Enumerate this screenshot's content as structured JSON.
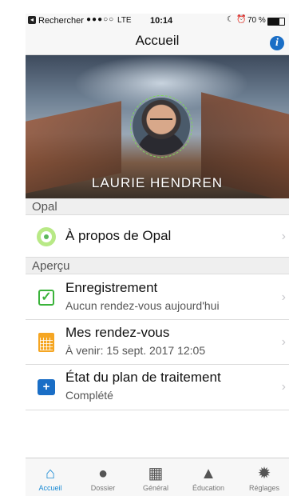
{
  "status_bar": {
    "carrier": "Rechercher",
    "signal": "●●●○○",
    "network": "LTE",
    "time": "10:14",
    "battery": "70 %"
  },
  "nav": {
    "title": "Accueil"
  },
  "profile": {
    "name": "LAURIE HENDREN"
  },
  "sections": {
    "opal": {
      "header": "Opal",
      "items": [
        {
          "title": "À propos de Opal",
          "icon": "opal-logo-icon"
        }
      ]
    },
    "apercu": {
      "header": "Aperçu",
      "items": [
        {
          "title": "Enregistrement",
          "subtitle": "Aucun rendez-vous aujourd'hui",
          "icon": "checkbox-icon"
        },
        {
          "title": "Mes rendez-vous",
          "subtitle": "À venir: 15 sept. 2017 12:05",
          "icon": "calendar-icon"
        },
        {
          "title": "État du plan de traitement",
          "subtitle": "Complété",
          "icon": "medkit-icon"
        }
      ]
    }
  },
  "tabs": [
    {
      "label": "Accueil",
      "icon": "home-icon",
      "active": true
    },
    {
      "label": "Dossier",
      "icon": "person-icon",
      "active": false
    },
    {
      "label": "Général",
      "icon": "grid-icon",
      "active": false
    },
    {
      "label": "Éducation",
      "icon": "graduation-cap-icon",
      "active": false
    },
    {
      "label": "Réglages",
      "icon": "gear-icon",
      "active": false
    }
  ],
  "colors": {
    "accent": "#1a8ad4",
    "check": "#3bb33b",
    "calendar": "#f5a623",
    "medkit": "#1a6ec6"
  }
}
